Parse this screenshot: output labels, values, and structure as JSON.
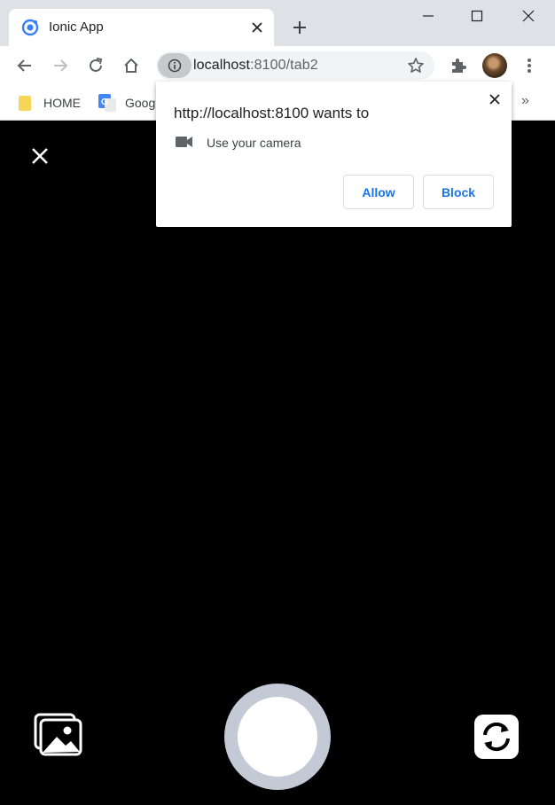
{
  "browser": {
    "tab": {
      "title": "Ionic App",
      "favicon": "ionic-logo-icon"
    },
    "window_controls": [
      "minimize-icon",
      "maximize-icon",
      "close-icon"
    ],
    "url": {
      "host": "localhost",
      "rest": ":8100/tab2"
    },
    "bookmarks": [
      {
        "label": "HOME",
        "icon": "folder-icon"
      },
      {
        "label": "Goog",
        "icon": "google-translate-icon"
      }
    ],
    "bookmarks_more": "»"
  },
  "permission_popup": {
    "title": "http://localhost:8100 wants to",
    "permission": "Use your camera",
    "allow_label": "Allow",
    "block_label": "Block"
  },
  "colors": {
    "accent_blue": "#1a73e8",
    "shutter_ring": "#c4c9d6",
    "tab_strip": "#dee1e6",
    "camera_bg": "#000000"
  }
}
